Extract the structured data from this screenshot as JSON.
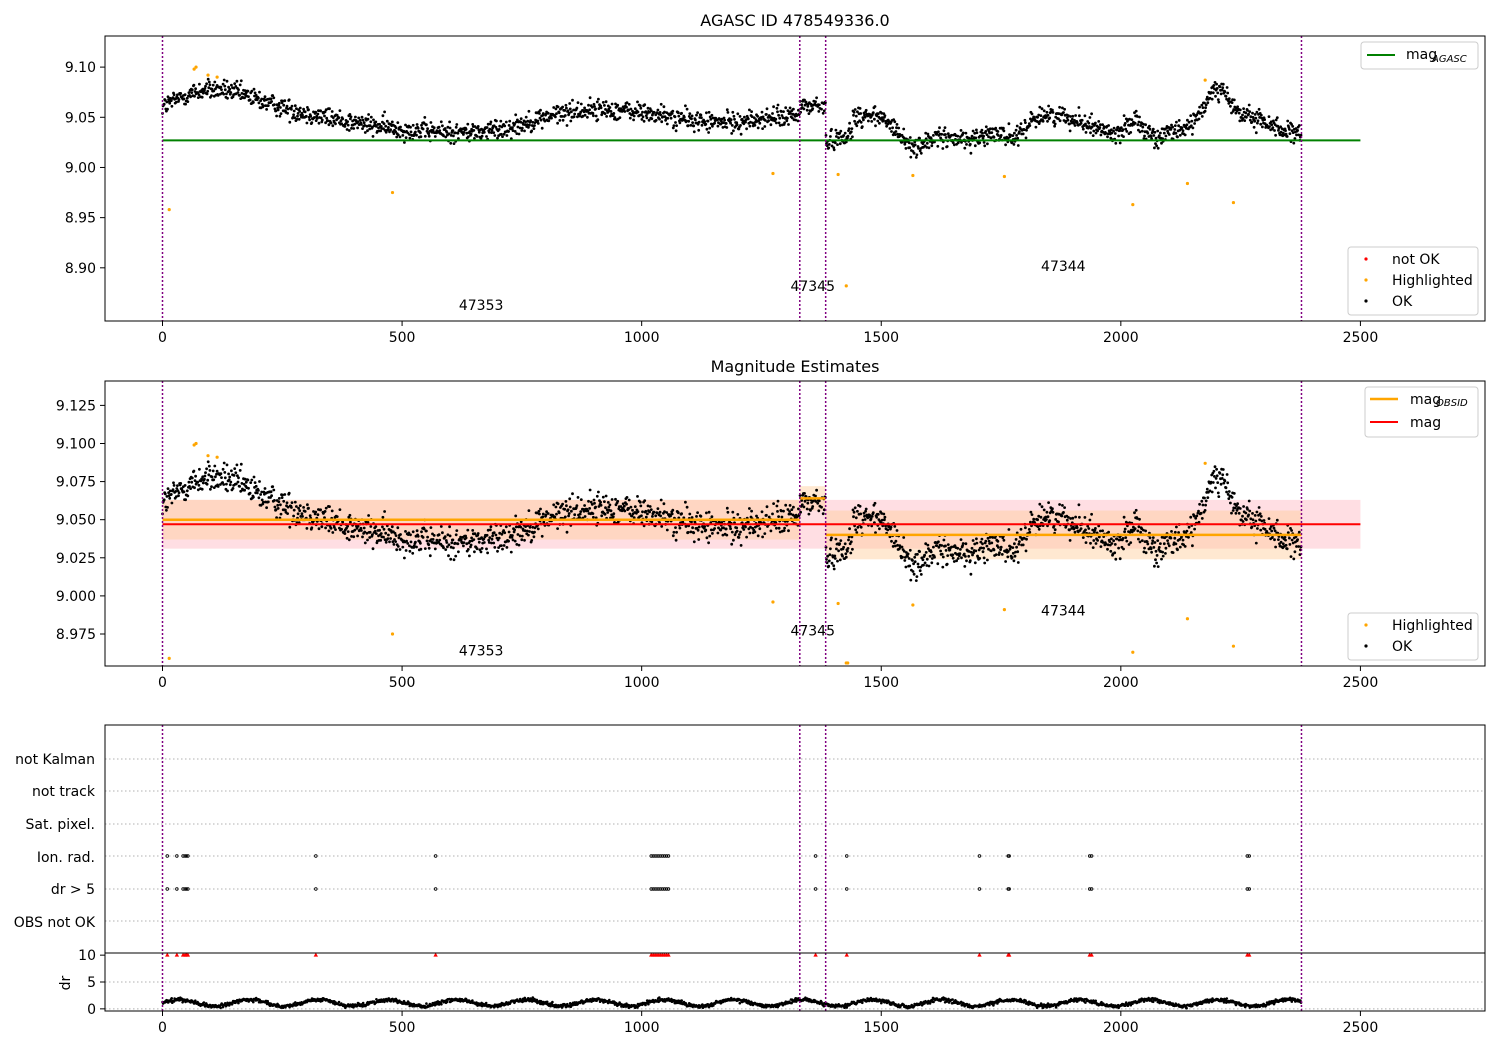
{
  "chart_data": [
    {
      "type": "scatter",
      "title": "AGASC ID 478549336.0",
      "xlim": [
        -120,
        2760
      ],
      "ylim": [
        8.847,
        9.131
      ],
      "x_ticks": [
        0,
        500,
        1000,
        1500,
        2000,
        2500
      ],
      "y_ticks": [
        8.9,
        8.95,
        9.0,
        9.05,
        9.1
      ],
      "y_tick_labels": [
        "8.90",
        "8.95",
        "9.00",
        "9.05",
        "9.10"
      ],
      "obsid_boundaries": [
        0,
        1330,
        1384,
        2377
      ],
      "obsid_labels": [
        {
          "text": "47353",
          "x": 665,
          "y": 8.858
        },
        {
          "text": "47345",
          "x": 1357,
          "y": 8.877
        },
        {
          "text": "47344",
          "x": 1880,
          "y": 8.897
        }
      ],
      "hlines": [
        {
          "name": "mag_AGASC",
          "y": 9.027,
          "x0": 0,
          "x1": 2500,
          "color": "#008000"
        }
      ],
      "legend_top": [
        {
          "label": "mag",
          "sub": "AGASC",
          "color": "#008000"
        }
      ],
      "legend_bottom": [
        {
          "label": "not OK",
          "color": "#ff0000"
        },
        {
          "label": "Highlighted",
          "color": "#ffa500"
        },
        {
          "label": "OK",
          "color": "#000000"
        }
      ],
      "highlighted_points": [
        [
          14,
          8.958
        ],
        [
          66,
          9.098
        ],
        [
          70,
          9.1
        ],
        [
          95,
          9.092
        ],
        [
          114,
          9.09
        ],
        [
          480,
          8.975
        ],
        [
          1274,
          8.994
        ],
        [
          1410,
          8.993
        ],
        [
          1427,
          8.882
        ],
        [
          1566,
          8.992
        ],
        [
          1757,
          8.991
        ],
        [
          2025,
          8.963
        ],
        [
          2139,
          8.984
        ],
        [
          2176,
          9.087
        ],
        [
          2235,
          8.965
        ]
      ]
    },
    {
      "type": "scatter",
      "title": "Magnitude Estimates",
      "xlim": [
        -120,
        2760
      ],
      "ylim": [
        8.954,
        9.141
      ],
      "x_ticks": [
        0,
        500,
        1000,
        1500,
        2000,
        2500
      ],
      "y_ticks": [
        8.975,
        9.0,
        9.025,
        9.05,
        9.075,
        9.1,
        9.125
      ],
      "y_tick_labels": [
        "8.975",
        "9.000",
        "9.025",
        "9.050",
        "9.075",
        "9.100",
        "9.125"
      ],
      "obsid_boundaries": [
        0,
        1330,
        1384,
        2377
      ],
      "obsid_labels": [
        {
          "text": "47353",
          "x": 665,
          "y": 8.961
        },
        {
          "text": "47345",
          "x": 1357,
          "y": 8.974
        },
        {
          "text": "47344",
          "x": 1880,
          "y": 8.987
        }
      ],
      "mag": {
        "value": 9.047,
        "band": [
          9.031,
          9.063
        ],
        "x0": 0,
        "x1": 2500,
        "color": "#ff0000"
      },
      "obsid_mags": [
        {
          "x0": 0,
          "x1": 1330,
          "value": 9.05,
          "band": [
            9.037,
            9.063
          ]
        },
        {
          "x0": 1330,
          "x1": 1384,
          "value": 9.064,
          "band": [
            9.056,
            9.072
          ]
        },
        {
          "x0": 1384,
          "x1": 2377,
          "value": 9.04,
          "band": [
            9.024,
            9.056
          ]
        }
      ],
      "legend_top": [
        {
          "label": "mag",
          "sub": "OBSID",
          "color": "#ffa500"
        },
        {
          "label": "mag",
          "sub": "",
          "color": "#ff0000"
        }
      ],
      "legend_bottom": [
        {
          "label": "Highlighted",
          "color": "#ffa500"
        },
        {
          "label": "OK",
          "color": "#000000"
        }
      ],
      "highlighted_points": [
        [
          14,
          8.959
        ],
        [
          66,
          9.099
        ],
        [
          70,
          9.1
        ],
        [
          95,
          9.092
        ],
        [
          114,
          9.091
        ],
        [
          480,
          8.975
        ],
        [
          1274,
          8.996
        ],
        [
          1410,
          8.995
        ],
        [
          1427,
          8.956
        ],
        [
          1430,
          8.956
        ],
        [
          1566,
          8.994
        ],
        [
          1757,
          8.991
        ],
        [
          2025,
          8.963
        ],
        [
          2139,
          8.985
        ],
        [
          2176,
          9.087
        ],
        [
          2235,
          8.967
        ]
      ]
    },
    {
      "type": "scatter",
      "title": "",
      "xlim": [
        -120,
        2760
      ],
      "x_ticks": [
        0,
        500,
        1000,
        1500,
        2000,
        2500
      ],
      "obsid_boundaries": [
        0,
        1330,
        1384,
        2377
      ],
      "flag_rows": [
        "not Kalman",
        "not track",
        "Sat. pixel.",
        "Ion. rad.",
        "dr > 5",
        "OBS not OK"
      ],
      "flag_points": {
        "Ion. rad.": [
          10,
          30,
          43,
          47,
          50,
          53,
          320,
          570,
          1020,
          1024,
          1028,
          1032,
          1036,
          1040,
          1044,
          1048,
          1052,
          1056,
          1363,
          1428,
          1705,
          1765,
          1767,
          1935,
          1939,
          2264,
          2268
        ],
        "dr > 5": [
          10,
          30,
          43,
          47,
          50,
          53,
          320,
          570,
          1020,
          1024,
          1028,
          1032,
          1036,
          1040,
          1044,
          1048,
          1052,
          1056,
          1363,
          1428,
          1705,
          1765,
          1767,
          1935,
          1939,
          2264,
          2268
        ]
      },
      "dr_axis": {
        "ylabel": "dr",
        "ylim": [
          -0.4,
          10.4
        ],
        "y_ticks": [
          0,
          5,
          10
        ]
      },
      "dr_outliers": [
        10,
        30,
        43,
        47,
        50,
        53,
        320,
        570,
        1020,
        1024,
        1028,
        1032,
        1036,
        1040,
        1044,
        1048,
        1052,
        1056,
        1363,
        1428,
        1705,
        1765,
        1767,
        1935,
        1939,
        2264,
        2268
      ],
      "dr_outlier_value": 10
    }
  ],
  "colors": {
    "ok": "#000000",
    "highlighted": "#ffa500",
    "not_ok": "#ff0000",
    "boundary": "#800080",
    "mag_band": "#ffb6c1",
    "obsid_band": "#ffcc99"
  }
}
